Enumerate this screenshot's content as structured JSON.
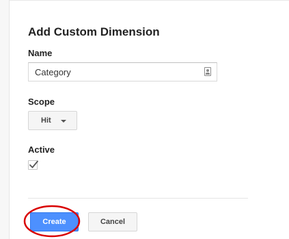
{
  "dialog": {
    "title": "Add Custom Dimension"
  },
  "name_field": {
    "label": "Name",
    "value": "Category",
    "icon": "contact-card-icon"
  },
  "scope_field": {
    "label": "Scope",
    "selected": "Hit"
  },
  "active_field": {
    "label": "Active",
    "checked": true
  },
  "buttons": {
    "create_label": "Create",
    "cancel_label": "Cancel"
  },
  "colors": {
    "primary_button": "#4d90fe",
    "highlight_annotation": "#d90000"
  }
}
